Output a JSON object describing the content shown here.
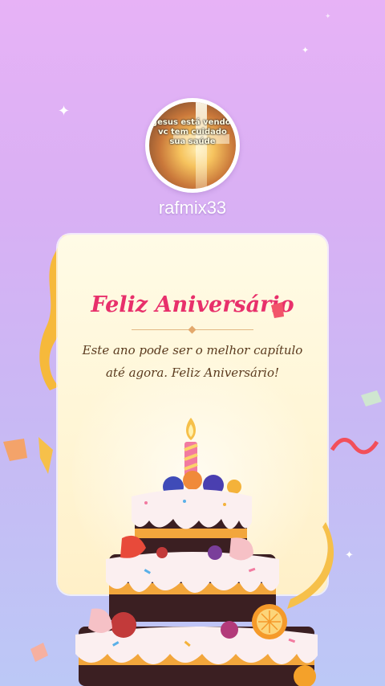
{
  "profile": {
    "avatar_text": "Jesus está vendo vc tem cuidado sua saúde",
    "username": "rafmix33"
  },
  "card": {
    "title": "Feliz Aniversário",
    "message": "Este ano pode ser o melhor capítulo até agora. Feliz Aniversário!"
  },
  "colors": {
    "title": "#e8306b",
    "message": "#5a3a1e",
    "background_top": "#e7b2f6",
    "background_bottom": "#bcc8f6",
    "card_background": "#fff6d7"
  },
  "icons": [
    "sparkle-icon",
    "ribbon",
    "confetti",
    "birthday-cake",
    "candle"
  ]
}
